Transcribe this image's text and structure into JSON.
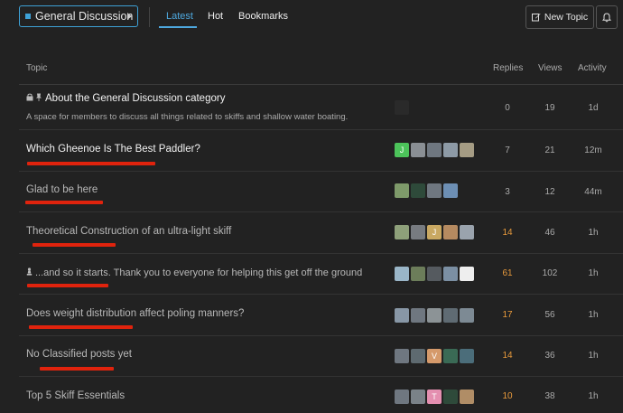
{
  "nav": {
    "category": "General Discussion",
    "tabs": [
      "Latest",
      "Hot",
      "Bookmarks"
    ],
    "new_topic": "New Topic"
  },
  "headers": {
    "topic": "Topic",
    "replies": "Replies",
    "views": "Views",
    "activity": "Activity"
  },
  "colors": {
    "accent": "#4ea8de",
    "hot": "#e89a3c",
    "annotation": "#e0230d"
  },
  "topics": [
    {
      "title": "About the General Discussion category",
      "excerpt": "A space for members to discuss all things related to skiffs and shallow water boating.",
      "pinned": true,
      "locked": true,
      "replies": "0",
      "views": "19",
      "activity": "1d",
      "avatars": [
        {
          "color": "#2a2a2a"
        }
      ]
    },
    {
      "title": "Which Gheenoe Is The Best Paddler?",
      "replies": "7",
      "views": "21",
      "activity": "12m",
      "avatars": [
        {
          "color": "#4cc35a",
          "letter": "J"
        },
        {
          "color": "#8a8f94"
        },
        {
          "color": "#6f7780"
        },
        {
          "color": "#8d9aa6"
        },
        {
          "color": "#a59c84"
        }
      ]
    },
    {
      "title": "Glad to be here",
      "replies": "3",
      "views": "12",
      "activity": "44m",
      "avatars": [
        {
          "color": "#7e9a6a"
        },
        {
          "color": "#2e4a3a"
        },
        {
          "color": "#6f7780"
        },
        {
          "color": "#6d8fb4"
        }
      ]
    },
    {
      "title": "Theoretical Construction of an ultra-light skiff",
      "replies": "14",
      "views": "46",
      "activity": "1h",
      "avatars": [
        {
          "color": "#8ea07a"
        },
        {
          "color": "#777b80"
        },
        {
          "color": "#c9a862",
          "letter": "J"
        },
        {
          "color": "#b58a60"
        },
        {
          "color": "#9aa3ad"
        }
      ]
    },
    {
      "title": "...and so it starts. Thank you to everyone for helping this get off the ground",
      "icon": "pawn",
      "replies": "61",
      "views": "102",
      "activity": "1h",
      "avatars": [
        {
          "color": "#9ab6c8"
        },
        {
          "color": "#6c7d5a"
        },
        {
          "color": "#555a5f"
        },
        {
          "color": "#7b8fa3"
        },
        {
          "color": "#eeeeee"
        }
      ]
    },
    {
      "title": "Does weight distribution affect poling manners?",
      "replies": "17",
      "views": "56",
      "activity": "1h",
      "avatars": [
        {
          "color": "#8897a6"
        },
        {
          "color": "#6f7780"
        },
        {
          "color": "#8c9396"
        },
        {
          "color": "#5f6b73"
        },
        {
          "color": "#7d8a94"
        }
      ]
    },
    {
      "title": "No Classified posts yet",
      "replies": "14",
      "views": "36",
      "activity": "1h",
      "avatars": [
        {
          "color": "#6f7780"
        },
        {
          "color": "#5e6a70"
        },
        {
          "color": "#d59a6b",
          "letter": "V"
        },
        {
          "color": "#3a6a55"
        },
        {
          "color": "#4b6d7a"
        }
      ]
    },
    {
      "title": "Top 5 Skiff Essentials",
      "replies": "10",
      "views": "38",
      "activity": "1h",
      "avatars": [
        {
          "color": "#6f7780"
        },
        {
          "color": "#7a8288"
        },
        {
          "color": "#e48fb0",
          "letter": "T"
        },
        {
          "color": "#2e4a3a"
        },
        {
          "color": "#b08d66"
        }
      ]
    }
  ]
}
